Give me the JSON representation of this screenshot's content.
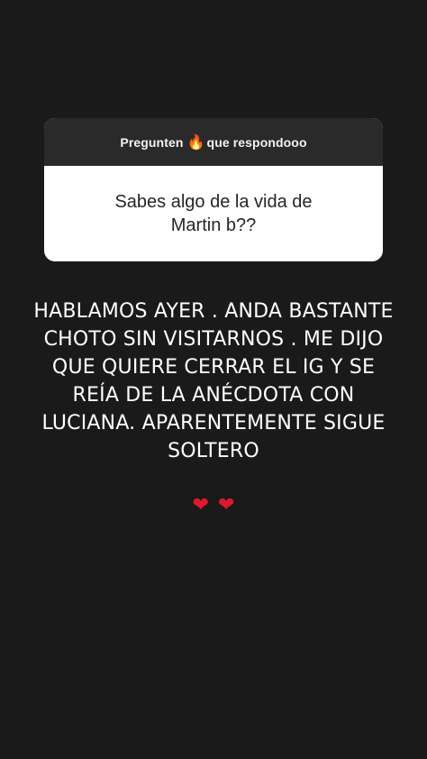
{
  "question_box": {
    "prompt_before": "Pregunten",
    "prompt_emoji": "🔥",
    "prompt_after": "que respondooo",
    "question": "Sabes algo de la vida de\nMartin b??"
  },
  "answer": {
    "text": "HABLAMOS AYER . ANDA BASTANTE\nCHOTO SIN VISITARNOS . ME DIJO\nQUE QUIERE CERRAR EL IG Y SE\nREÍA DE LA ANÉCDOTA CON\nLUCIANA. APARENTEMENTE SIGUE\nSOLTERO"
  },
  "hearts": {
    "first": "❤",
    "second": "❤",
    "color": "#e0182d"
  },
  "colors": {
    "background": "#1a1a1a",
    "card_header": "#2a2a2a",
    "card_body": "#ffffff"
  }
}
